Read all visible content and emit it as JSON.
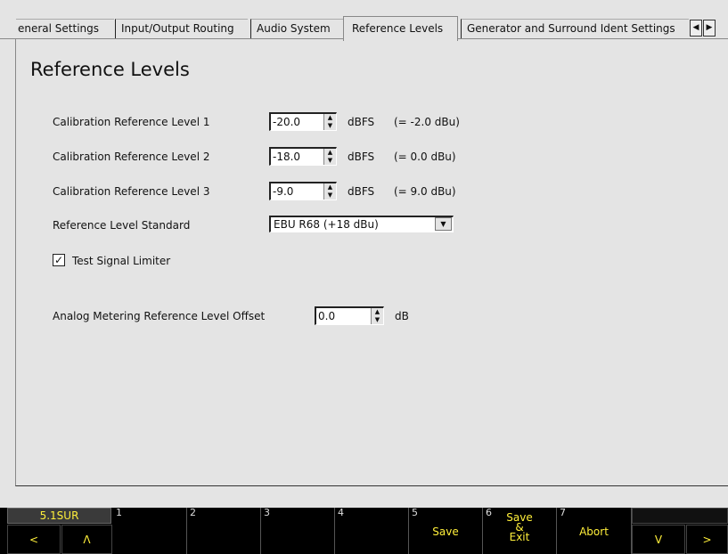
{
  "tabs": [
    {
      "label": "eneral Settings",
      "active": false
    },
    {
      "label": "Input/Output Routing",
      "active": false
    },
    {
      "label": "Audio System",
      "active": false
    },
    {
      "label": "Reference Levels",
      "active": true
    },
    {
      "label": "Generator and Surround Ident Settings",
      "active": false
    }
  ],
  "tab_scroll": {
    "left": "◀",
    "right": "▶"
  },
  "page": {
    "title": "Reference Levels"
  },
  "fields": {
    "cal1": {
      "label": "Calibration Reference Level 1",
      "value": "-20.0",
      "unit": "dBFS",
      "equiv": "(= -2.0 dBu)"
    },
    "cal2": {
      "label": "Calibration Reference Level 2",
      "value": "-18.0",
      "unit": "dBFS",
      "equiv": "(= 0.0 dBu)"
    },
    "cal3": {
      "label": "Calibration Reference Level 3",
      "value": "-9.0",
      "unit": "dBFS",
      "equiv": "(= 9.0 dBu)"
    },
    "standard": {
      "label": "Reference Level Standard",
      "value": "EBU R68 (+18 dBu)"
    },
    "limiter": {
      "label": "Test Signal Limiter",
      "checked": true,
      "mark": "✓"
    },
    "offset": {
      "label": "Analog Metering Reference Level Offset",
      "value": "0.0",
      "unit": "dB"
    }
  },
  "spin_arrows": {
    "up": "▲",
    "down": "▼"
  },
  "dropdown_arrow": "▼",
  "function_bar": {
    "preset": "5.1SUR",
    "nav_left": "<",
    "nav_up": "Λ",
    "keys": [
      {
        "num": "1",
        "label": ""
      },
      {
        "num": "2",
        "label": ""
      },
      {
        "num": "3",
        "label": ""
      },
      {
        "num": "4",
        "label": ""
      },
      {
        "num": "5",
        "label": "Save"
      },
      {
        "num": "6",
        "label": "Save\n&\nExit"
      },
      {
        "num": "7",
        "label": "Abort"
      }
    ],
    "nav_down": "V",
    "nav_right": ">"
  }
}
